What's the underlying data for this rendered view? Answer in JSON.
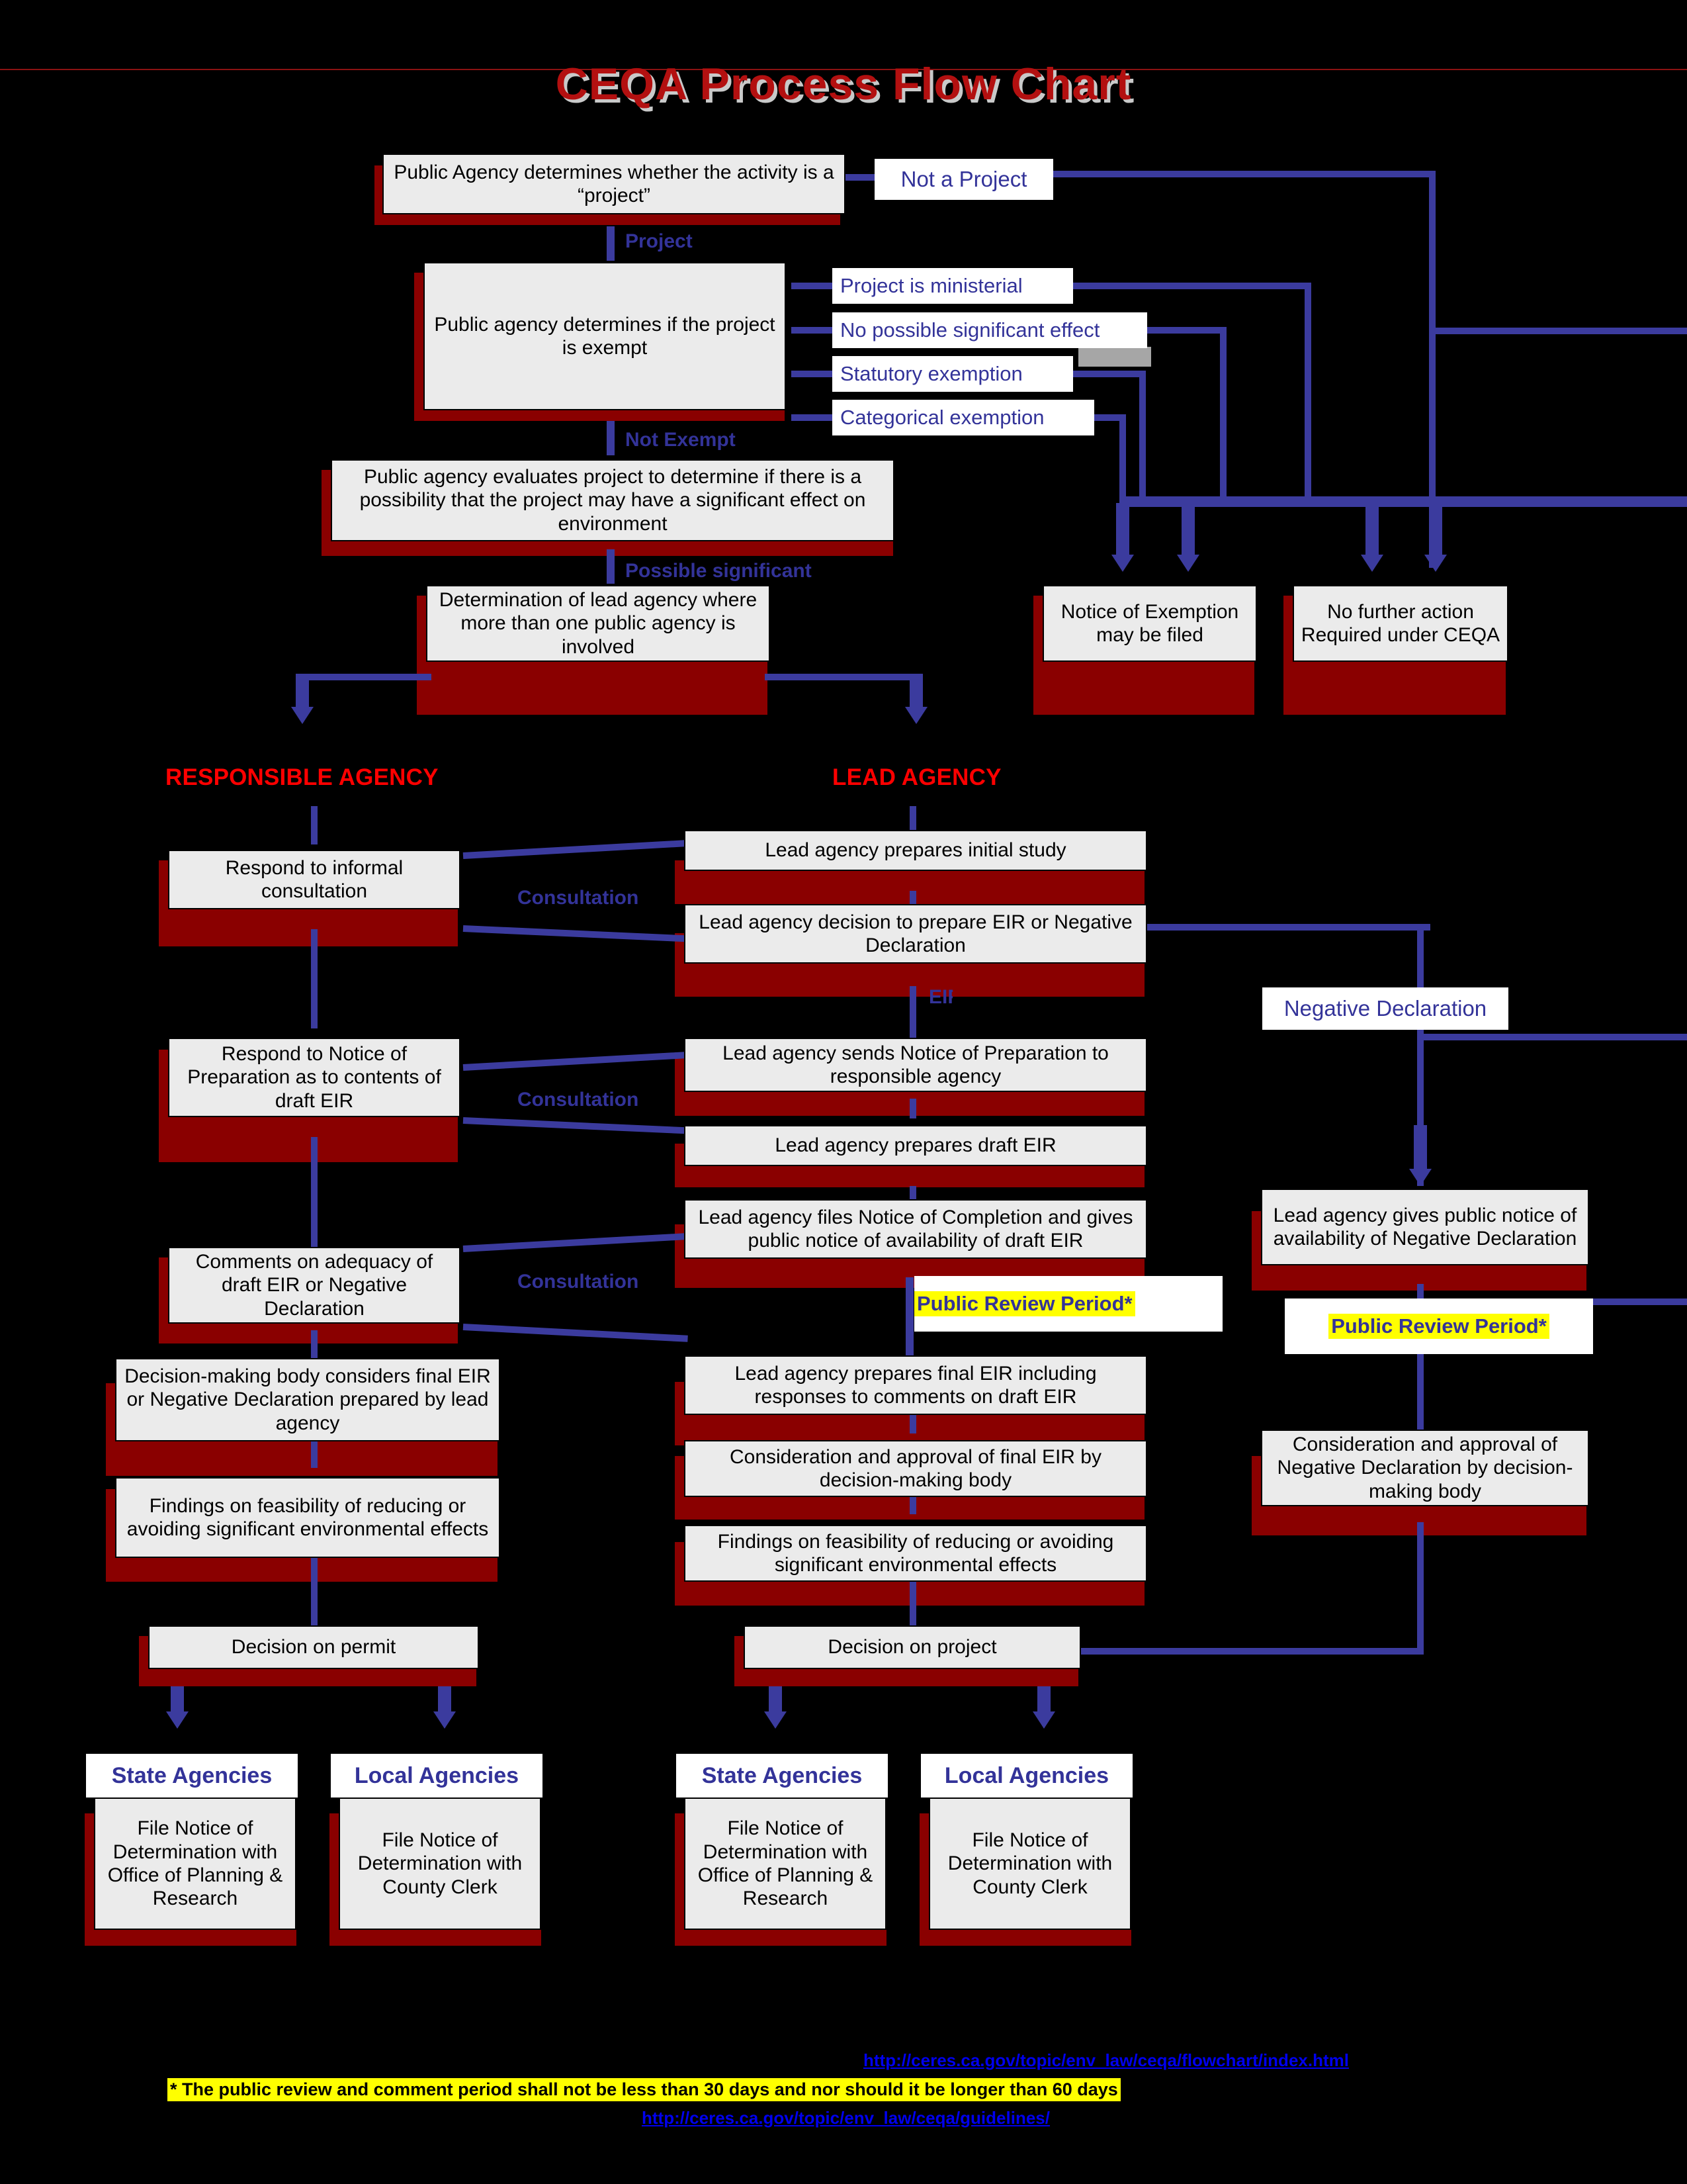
{
  "title": "CEQA Process Flow Chart",
  "colors": {
    "background": "#000000",
    "node_fill": "#ebebeb",
    "node_shadow": "#8a0000",
    "connector": "#3b3b9e",
    "label_blue": "#333399",
    "agency_red": "#ff0000",
    "title_red": "#b31010",
    "highlight_yellow": "#ffff00",
    "link_blue": "#0000ee"
  },
  "nodes": {
    "determine_project": "Public Agency determines whether the activity is a “project”",
    "determine_exempt": "Public agency determines if the project is exempt",
    "evaluate_effect": "Public agency evaluates project to determine if there is a possibility that the project may have a significant effect on environment",
    "lead_agency_determination": "Determination of lead agency where more than one public agency is involved",
    "notice_of_exemption": "Notice of Exemption may be filed",
    "no_further_action": "No further action Required under CEQA",
    "respond_informal": "Respond to informal consultation",
    "respond_nop": "Respond to Notice of Preparation as to contents of draft EIR",
    "comments_adequacy": "Comments on adequacy of draft EIR or Negative Declaration",
    "decision_body_considers": "Decision-making body considers final EIR or Negative Declaration prepared by lead agency",
    "findings_left": "Findings on feasibility of reducing or avoiding significant environmental effects",
    "decision_on_permit": "Decision on permit",
    "initial_study": "Lead agency prepares initial study",
    "decision_eir_or_nd": "Lead agency decision to prepare EIR or Negative Declaration",
    "sends_nop": "Lead agency sends Notice of Preparation to responsible agency",
    "prepares_draft_eir": "Lead agency prepares draft EIR",
    "files_noc": "Lead agency files Notice of Completion and gives public notice of availability of draft EIR",
    "prepares_final_eir": "Lead agency prepares final EIR including responses to comments on draft EIR",
    "approval_final_eir": "Consideration and approval of final EIR by decision-making body",
    "findings_center": "Findings on feasibility of reducing or avoiding significant environmental effects",
    "decision_on_project": "Decision on project",
    "public_notice_nd": "Lead agency gives public notice of availability of Negative Declaration",
    "approval_nd": "Consideration and approval of Negative Declaration by decision-making body",
    "file_nod_state_left": "File Notice of Determination with Office of Planning & Research",
    "file_nod_local_left": "File Notice of Determination with County Clerk",
    "file_nod_state_right": "File Notice of Determination with Office of Planning & Research",
    "file_nod_local_right": "File Notice of Determination with County Clerk"
  },
  "outcome_labels": {
    "not_a_project": "Not a Project",
    "ministerial": "Project is ministerial",
    "no_significant_effect": "No possible significant effect",
    "statutory_exemption": "Statutory exemption",
    "categorical_exemption": "Categorical exemption",
    "negative_declaration": "Negative Declaration"
  },
  "edge_labels": {
    "project": "Project",
    "not_exempt": "Not Exempt",
    "possible_significant": "Possible significant",
    "eir": "EIR",
    "consultation_1": "Consultation",
    "consultation_2": "Consultation",
    "consultation_3": "Consultation"
  },
  "swimlanes": {
    "responsible_agency": "RESPONSIBLE AGENCY",
    "lead_agency": "LEAD AGENCY"
  },
  "agency_headers": {
    "state_left": "State Agencies",
    "local_left": "Local Agencies",
    "state_right": "State Agencies",
    "local_right": "Local Agencies"
  },
  "review_periods": {
    "center": "Public Review Period*",
    "right": "Public Review Period*"
  },
  "footer": {
    "link_top": "http://ceres.ca.gov/topic/env_law/ceqa/flowchart/index.html",
    "note": "* The public review and comment period shall not be less than 30 days and nor should it be longer than 60 days",
    "link_bottom": "http://ceres.ca.gov/topic/env_law/ceqa/guidelines/"
  }
}
